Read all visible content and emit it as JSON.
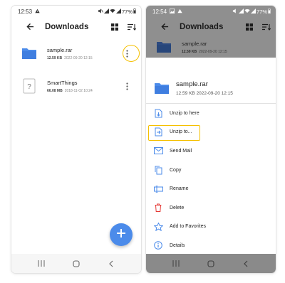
{
  "left": {
    "status": {
      "time": "12:53",
      "battery": "77%"
    },
    "appbar": {
      "title": "Downloads"
    },
    "files": [
      {
        "name": "sample.rar",
        "size": "12.59 KB",
        "date": "2022-09-20 12:15"
      },
      {
        "name": "SmartThings",
        "size": "66.08 MB",
        "date": "2018-11-02 10:24"
      }
    ]
  },
  "right": {
    "status": {
      "time": "12:54",
      "battery": "77%"
    },
    "appbar": {
      "title": "Downloads"
    },
    "dim_file": {
      "name": "sample.rar",
      "size": "12.59 KB",
      "date": "2022-09-20 12:15"
    },
    "sheet": {
      "name": "sample.rar",
      "size": "12.59 KB",
      "date": "2022-09-20 12:15",
      "items": [
        {
          "label": "Unzip to here",
          "icon": "unzip-here-icon"
        },
        {
          "label": "Unzip to...",
          "icon": "unzip-to-icon"
        },
        {
          "label": "Send Mail",
          "icon": "mail-icon"
        },
        {
          "label": "Copy",
          "icon": "copy-icon"
        },
        {
          "label": "Rename",
          "icon": "rename-icon"
        },
        {
          "label": "Delete",
          "icon": "delete-icon"
        },
        {
          "label": "Add to Favorites",
          "icon": "star-icon"
        },
        {
          "label": "Details",
          "icon": "info-icon"
        }
      ]
    }
  },
  "colors": {
    "accent": "#4b8bea",
    "highlight": "#f5c000",
    "delete": "#e53935"
  }
}
